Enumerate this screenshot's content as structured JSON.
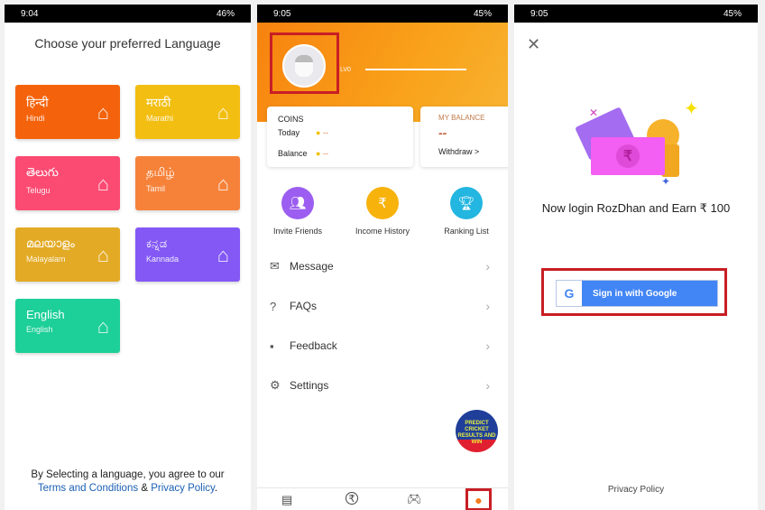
{
  "screen1": {
    "status": {
      "time": "9:04",
      "battery": "46%"
    },
    "title": "Choose your preferred Language",
    "languages": [
      {
        "native": "हिन्दी",
        "english": "Hindi",
        "color": "#f4630c"
      },
      {
        "native": "मराठी",
        "english": "Marathi",
        "color": "#f2be12"
      },
      {
        "native": "తెలుగు",
        "english": "Telugu",
        "color": "#fb4b72"
      },
      {
        "native": "தமிழ்",
        "english": "Tamil",
        "color": "#f6823a"
      },
      {
        "native": "മലയാളം",
        "english": "Malayalam",
        "color": "#e3aa25"
      },
      {
        "native": "ಕನ್ನಡ",
        "english": "Kannada",
        "color": "#8358f5"
      },
      {
        "native": "English",
        "english": "English",
        "color": "#1dcf98"
      }
    ],
    "footer": {
      "text": "By Selecting a language, you agree to our",
      "terms": "Terms and Conditions",
      "amp": "&",
      "privacy": "Privacy Policy",
      "period": "."
    }
  },
  "screen2": {
    "status": {
      "time": "9:05",
      "battery": "45%"
    },
    "level": "LV0",
    "coins": {
      "title": "COINS",
      "today_label": "Today",
      "today_value": "--",
      "balance_label": "Balance",
      "balance_value": "--"
    },
    "balance": {
      "title": "MY BALANCE",
      "value": "--",
      "withdraw": "Withdraw >"
    },
    "quick": [
      {
        "label": "Invite Friends",
        "icon": "people-icon",
        "color": "#9b5ef0"
      },
      {
        "label": "Income History",
        "icon": "rupee-receipt-icon",
        "color": "#f7b20c"
      },
      {
        "label": "Ranking List",
        "icon": "trophy-icon",
        "color": "#22b6e0"
      }
    ],
    "menu": [
      {
        "label": "Message",
        "icon": "mail-icon"
      },
      {
        "label": "FAQs",
        "icon": "question-icon"
      },
      {
        "label": "Feedback",
        "icon": "chat-icon"
      },
      {
        "label": "Settings",
        "icon": "gear-icon"
      }
    ],
    "promo": "PREDICT CRICKET RESULTS AND WIN"
  },
  "screen3": {
    "status": {
      "time": "9:05",
      "battery": "45%"
    },
    "message": "Now login RozDhan and Earn ₹ 100",
    "signin": "Sign in with Google",
    "privacy": "Privacy Policy",
    "accent": "#4285f4"
  }
}
